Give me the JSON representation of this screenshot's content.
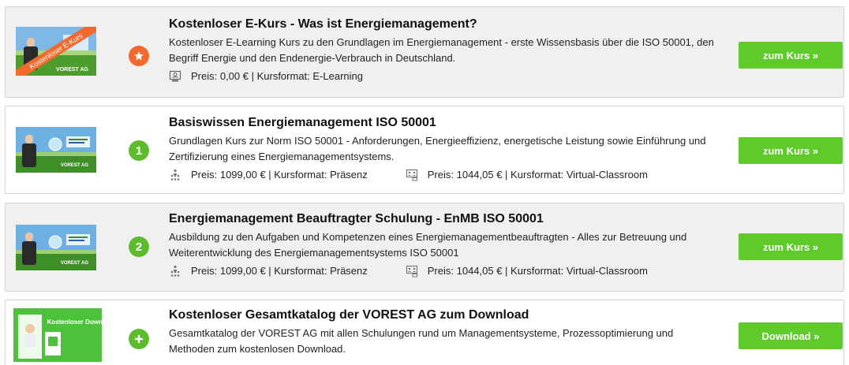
{
  "colors": {
    "accent_green": "#5fcb2a",
    "badge_orange": "#f26a2e",
    "badge_green": "#5dbb2e",
    "card_shaded": "#f0f0f0",
    "border": "#d4d4d4"
  },
  "courses": [
    {
      "thumb_banner": "Kostenloser E-Kurs",
      "thumb_brand": "VOREST AG",
      "badge": "★",
      "badge_icon": "star-icon",
      "title": "Kostenloser E-Kurs - Was ist Energiemanagement?",
      "description": "Kostenloser E-Learning Kurs zu den Grundlagen im Energiemanagement - erste Wissensbasis über die ISO 50001, den Begriff Energie und den Endenergie-Verbrauch in Deutschland.",
      "meta": [
        {
          "icon": "elearning-icon",
          "text": "Preis: 0,00 € | Kursformat: E-Learning"
        }
      ],
      "button": "zum Kurs »"
    },
    {
      "thumb_brand": "VOREST AG",
      "badge": "1",
      "title": "Basiswissen Energiemanagement ISO 50001",
      "description": "Grundlagen Kurs zur Norm ISO 50001 - Anforderungen, Energieeffizienz, energetische Leistung sowie Einführung und Zertifizierung eines Energiemanagementsystems.",
      "meta": [
        {
          "icon": "classroom-icon",
          "text": "Preis: 1099,00 € | Kursformat: Präsenz"
        },
        {
          "icon": "virtual-classroom-icon",
          "text": "Preis: 1044,05 € | Kursformat: Virtual-Classroom"
        }
      ],
      "button": "zum Kurs »"
    },
    {
      "thumb_brand": "VOREST AG",
      "badge": "2",
      "title": "Energiemanagement Beauftragter Schulung - EnMB ISO 50001",
      "description": "Ausbildung zu den Aufgaben und Kompetenzen eines Energiemanagementbeauftragten - Alles zur Betreuung und Weiterentwicklung des Energiemanagementsystems ISO 50001",
      "meta": [
        {
          "icon": "classroom-icon",
          "text": "Preis: 1099,00 € | Kursformat: Präsenz"
        },
        {
          "icon": "virtual-classroom-icon",
          "text": "Preis: 1044,05 € | Kursformat: Virtual-Classroom"
        }
      ],
      "button": "zum Kurs »"
    },
    {
      "thumb_banner": "Kostenloser Download",
      "badge": "+",
      "badge_icon": "plus-icon",
      "title": "Kostenloser Gesamtkatalog der VOREST AG zum Download",
      "description": "Gesamtkatalog der VOREST AG mit allen Schulungen rund um Managementsysteme, Prozessoptimierung und Methoden zum kostenlosen Download.",
      "meta": [],
      "button": "Download »"
    }
  ]
}
